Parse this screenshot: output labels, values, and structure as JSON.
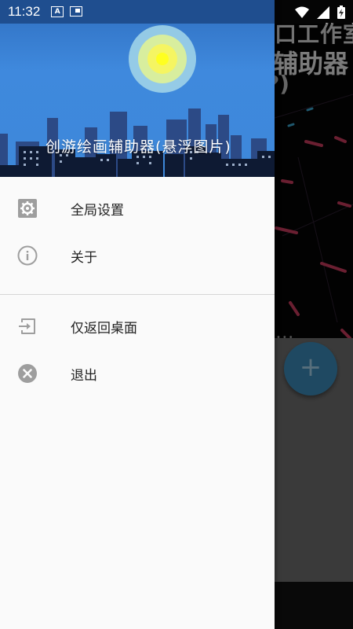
{
  "status_bar": {
    "time": "11:32",
    "a_badge": "A"
  },
  "background": {
    "title_line1": "口工作室",
    "title_line2": "辅助器",
    "title_line3": "?)",
    "fab_label": "+",
    "dots": "•••"
  },
  "drawer": {
    "header_title": "创游绘画辅助器(悬浮图片)",
    "section1": [
      {
        "label": "全局设置",
        "icon": "gear-icon"
      },
      {
        "label": "关于",
        "icon": "info-icon"
      }
    ],
    "section2": [
      {
        "label": "仅返回桌面",
        "icon": "exit-to-app-icon"
      },
      {
        "label": "退出",
        "icon": "close-circle-icon"
      }
    ]
  },
  "colors": {
    "header_blue": "#3d88da",
    "fab_blue": "#3a86b2",
    "drawer_bg": "#fafafa",
    "icon_gray": "#9e9e9e"
  }
}
